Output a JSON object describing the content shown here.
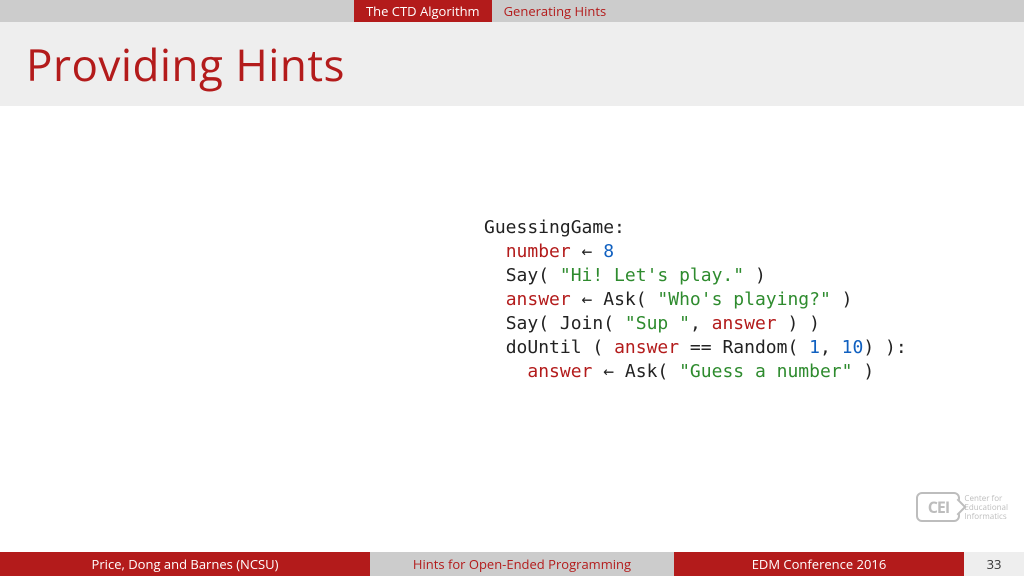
{
  "topbar": {
    "tab_active": "The CTD Algorithm",
    "tab_inactive": "Generating Hints"
  },
  "title": "Providing Hints",
  "code": {
    "line1_label": "GuessingGame:",
    "line2_var": "number",
    "line2_arrow": " ← ",
    "line2_num": "8",
    "line3_pre": "Say( ",
    "line3_str": "\"Hi! Let's play.\"",
    "line3_post": " )",
    "line4_var": "answer",
    "line4_arrow": " ← Ask( ",
    "line4_str": "\"Who's playing?\"",
    "line4_post": " )",
    "line5_pre": "Say( Join( ",
    "line5_str": "\"Sup \"",
    "line5_mid": ", ",
    "line5_var": "answer",
    "line5_post": " ) )",
    "line6_pre": "doUntil ( ",
    "line6_var": "answer",
    "line6_mid": " == Random( ",
    "line6_num1": "1",
    "line6_comma": ", ",
    "line6_num2": "10",
    "line6_post": ") ):",
    "line7_var": "answer",
    "line7_arrow": " ← Ask( ",
    "line7_str": "\"Guess a number\"",
    "line7_post": " )"
  },
  "logo": {
    "mark": "CEI",
    "line1": "Center for",
    "line2": "Educational",
    "line3": "Informatics"
  },
  "footer": {
    "authors": "Price, Dong and Barnes (NCSU)",
    "title": "Hints for Open-Ended Programming",
    "venue": "EDM Conference 2016",
    "page": "33"
  }
}
